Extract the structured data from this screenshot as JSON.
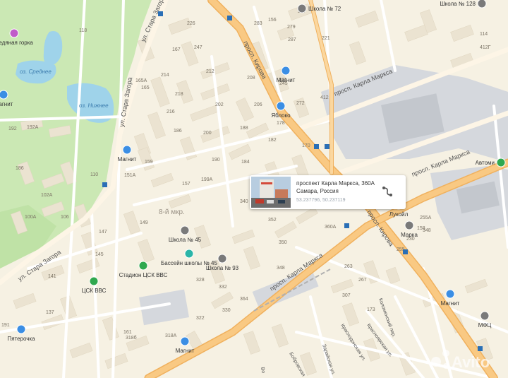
{
  "streets": {
    "kirova_top": "просп. Кирова",
    "kirova_bottom": "просп. Кирова",
    "karla_marksa_top": "просп. Карла Маркса",
    "karla_marksa_right": "просп. Карла Маркса",
    "karla_marksa_bottom": "просп. Карла Маркса",
    "stara_zagora_top": "ул. Стара Загора",
    "stara_zagora_mid": "ул. Стара Загора",
    "stara_zagora_bottom": "ул. Стара Загора",
    "kolomenskiy": "Коломенский пер.",
    "krasnodonskaya": "Краснодонская ул.",
    "krasnoyarskaya": "Красноярская ул.",
    "zaraiskaya": "Зарайская ул.",
    "bobrovskaya": "Бобровская",
    "vo": "Во"
  },
  "places": {
    "ledyanaya_gorka": "Ледяная горка",
    "oz_srednee": "оз. Среднее",
    "oz_nizhnee": "оз. Нижнее",
    "district": "8-й мкр.",
    "shkola72": "Школа № 72",
    "shkola128": "Школа № 128",
    "shkola45": "Школа № 45",
    "shkola93": "Школа № 93",
    "basseyn": "Бассейн школы № 45",
    "stadion": "Стадион ЦСК ВВС",
    "csk": "ЦСК ВВС",
    "magnit_top": "Магнит",
    "magnit_left": "Магнит",
    "magnit_mid": "Магнит",
    "magnit_bottom": "Магнит",
    "magnit_right": "Магнит",
    "yabloko": "Яблоко",
    "pyaterochka": "Пятерочка",
    "lukoil": "Лукойл",
    "marka": "Марка",
    "mfc": "МФЦ",
    "avtomir": "Автоми"
  },
  "houses": [
    "277",
    "279",
    "283",
    "287",
    "271",
    "226",
    "247",
    "167",
    "212",
    "208",
    "206",
    "202",
    "188",
    "200",
    "186",
    "182",
    "190",
    "184",
    "178",
    "170",
    "218",
    "216",
    "214",
    "165А",
    "165",
    "192",
    "192А",
    "186",
    "102А",
    "100А",
    "106",
    "110",
    "151А",
    "159",
    "157",
    "199А",
    "340",
    "352",
    "360А",
    "350",
    "348",
    "332",
    "330",
    "328",
    "147",
    "149",
    "145",
    "141",
    "137",
    "191",
    "318б",
    "318А",
    "322",
    "161",
    "307",
    "263",
    "267",
    "272",
    "245",
    "173",
    "221",
    "156",
    "158",
    "230",
    "255",
    "255А",
    "348",
    "364",
    "412",
    "412Г",
    "114",
    "118"
  ],
  "popup": {
    "address_line1": "проспект Карла Маркса, 360А",
    "address_line2": "Самара, Россия",
    "coords": "53.237796, 50.237119"
  },
  "watermark": "Avito",
  "colors": {
    "background": "#f6f1e3",
    "park": "#cbe8b4",
    "water": "#9fd3ea",
    "major_road": "#f9c983",
    "road": "#ffffff",
    "building": "#ebe3d1",
    "industrial": "#d5d8dd",
    "label": "#6b6459",
    "poi": "#3b8ee4"
  }
}
